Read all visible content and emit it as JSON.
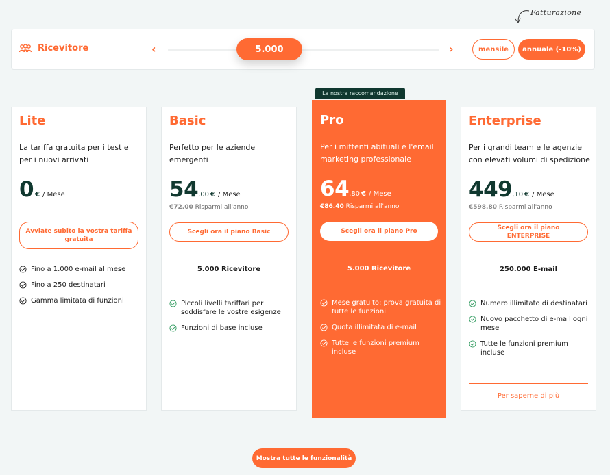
{
  "billing": {
    "hint": "Fatturazione",
    "monthly_label": "mensile",
    "annual_label": "annuale (-10%)"
  },
  "recipient": {
    "label": "Ricevitore",
    "value": "5.000",
    "prev_icon": "chevron-left-icon",
    "next_icon": "chevron-right-icon",
    "icon": "users-icon"
  },
  "colors": {
    "accent": "#ff6a33",
    "dark": "#10382f",
    "badge_bg": "#10382f"
  },
  "recommended_badge": "La nostra raccomandazione",
  "plans": [
    {
      "name": "Lite",
      "desc": "La tariffa gratuita per i test e per i nuovi arrivati",
      "price": "0",
      "decimals": "",
      "currency": "€",
      "period": "/ Mese",
      "old_price": "",
      "savings": "",
      "cta": "Avviate subito la vostra tariffa gratuita",
      "quota": "",
      "features": [
        "Fino a 1.000 e-mail al mese",
        "Fino a 250 destinatari",
        "Gamma limitata di funzioni"
      ]
    },
    {
      "name": "Basic",
      "desc": "Perfetto per le aziende emergenti",
      "price": "54",
      "decimals": ",00",
      "currency": "€",
      "period": "/ Mese",
      "old_price": "€72.00",
      "savings": "Risparmi all'anno",
      "cta": "Scegli ora il piano Basic",
      "quota": "5.000 Ricevitore",
      "features": [
        "Piccoli livelli tariffari per soddisfare le vostre esigenze",
        "Funzioni di base incluse"
      ]
    },
    {
      "name": "Pro",
      "desc": "Per i mittenti abituali e l'email marketing professionale",
      "price": "64",
      "decimals": ",80",
      "currency": "€",
      "period": "/ Mese",
      "old_price": "€86.40",
      "savings": "Risparmi all'anno",
      "cta": "Scegli ora il piano Pro",
      "quota": "5.000 Ricevitore",
      "features": [
        "Mese gratuito: prova gratuita di tutte le funzioni",
        "Quota illimitata di e-mail",
        "Tutte le funzioni premium incluse"
      ]
    },
    {
      "name": "Enterprise",
      "desc": "Per i grandi team e le agenzie con elevati volumi di spedizione",
      "price": "449",
      "decimals": ",10",
      "currency": "€",
      "period": "/ Mese",
      "old_price": "€598.80",
      "savings": "Risparmi all'anno",
      "cta": "Scegli ora il piano ENTERPRISE",
      "quota": "250.000 E-mail",
      "features": [
        "Numero illimitato di destinatari",
        "Nuovo pacchetto di e-mail ogni mese",
        "Tutte le funzioni premium incluse"
      ],
      "more_link": "Per saperne di più"
    }
  ],
  "show_all_button": "Mostra tutte le funzionalità"
}
